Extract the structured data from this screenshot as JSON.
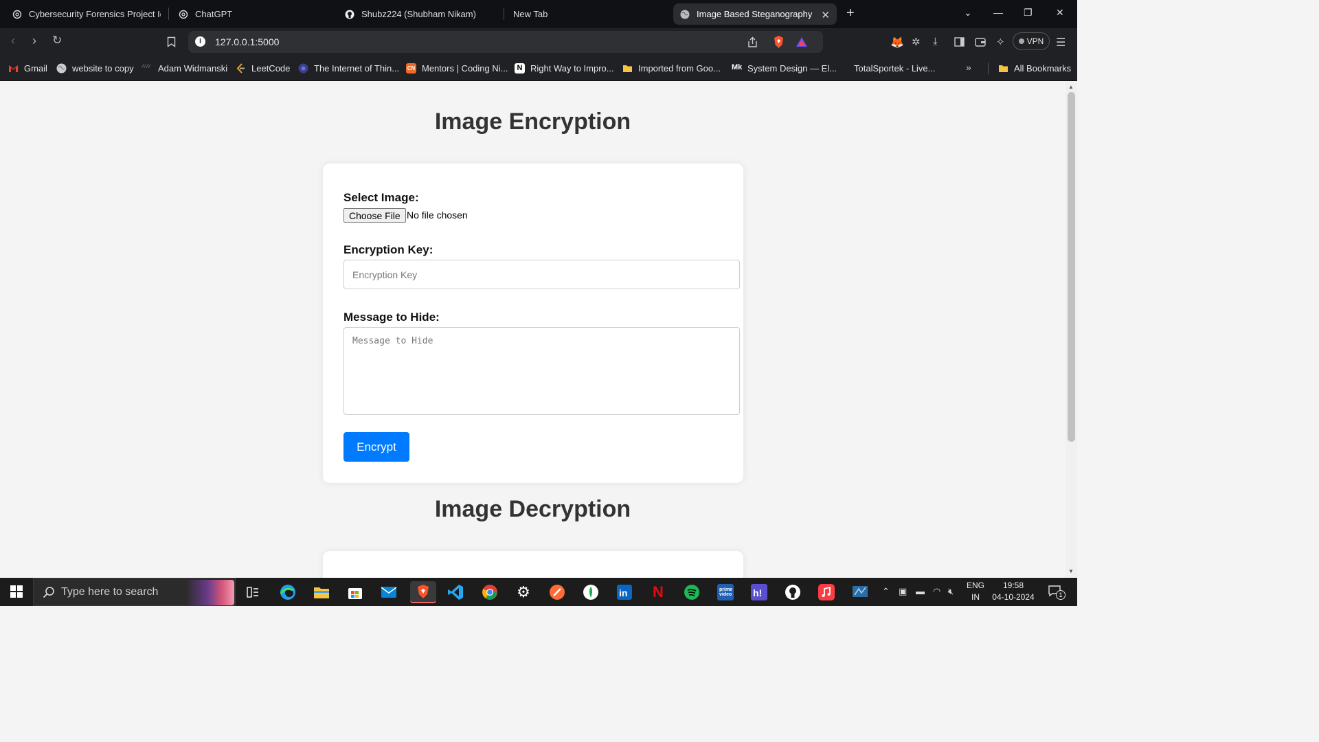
{
  "browser": {
    "tabs": [
      {
        "title": "Cybersecurity Forensics Project Idea"
      },
      {
        "title": "ChatGPT"
      },
      {
        "title": "Shubz224 (Shubham Nikam)"
      },
      {
        "title": "New Tab"
      },
      {
        "title": "Image Based Steganography"
      }
    ],
    "url": "127.0.0.1:5000",
    "vpn_label": "VPN",
    "bookmarks": [
      {
        "label": "Gmail"
      },
      {
        "label": "website to copy"
      },
      {
        "label": "Adam Widmanski"
      },
      {
        "label": "LeetCode"
      },
      {
        "label": "The Internet of Thin..."
      },
      {
        "label": "Mentors | Coding Ni..."
      },
      {
        "label": "Right Way to Impro..."
      },
      {
        "label": "Imported from Goo..."
      },
      {
        "label": "System Design — El..."
      },
      {
        "label": "TotalSportek - Live..."
      }
    ],
    "all_bookmarks_label": "All Bookmarks"
  },
  "page": {
    "encrypt_heading": "Image Encryption",
    "select_image_label": "Select Image:",
    "choose_file_label": "Choose File",
    "no_file_text": "No file chosen",
    "key_label": "Encryption Key:",
    "key_placeholder": "Encryption Key",
    "message_label": "Message to Hide:",
    "message_placeholder": "Message to Hide",
    "encrypt_button": "Encrypt",
    "decrypt_heading": "Image Decryption"
  },
  "taskbar": {
    "search_placeholder": "Type here to search",
    "language_top": "ENG",
    "language_bottom": "IN",
    "time": "19:58",
    "date": "04-10-2024",
    "notification_count": "1"
  },
  "colors": {
    "primary": "#007bff",
    "tab_bar": "#0f1115",
    "toolbar": "#202124",
    "page_bg": "#f4f4f4",
    "taskbar": "#1c1c1c"
  }
}
